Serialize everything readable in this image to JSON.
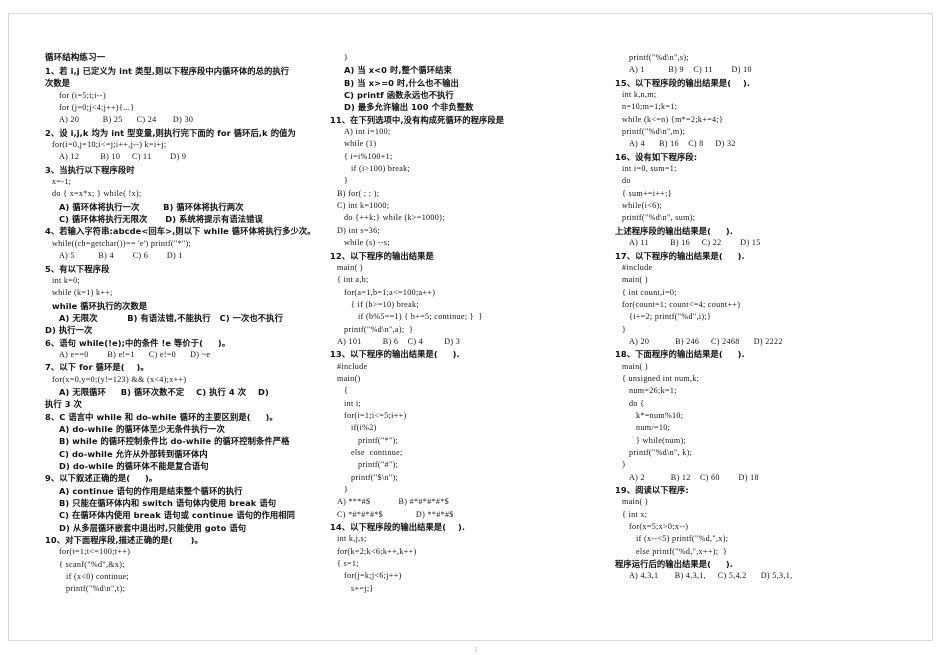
{
  "document": {
    "title": "循环结构练习一",
    "page_number": "1",
    "page_count_columns": 3
  },
  "columns": [
    {
      "name": "column-1",
      "lines": [
        {
          "text": "循环结构练习一",
          "kind": "title",
          "indent": 0
        },
        {
          "text": "1、若 i,j 已定义为 int 类型,则以下程序段中内循环体的总的执行",
          "kind": "cn",
          "indent": 0
        },
        {
          "text": "次数是",
          "kind": "cn",
          "indent": 0
        },
        {
          "text": "for (i=5;i;i--)",
          "kind": "code",
          "indent": 2
        },
        {
          "text": "for (j=0;j<4;j++){...}",
          "kind": "code",
          "indent": 2
        },
        {
          "text": "A) 20          B) 25      C) 24       D) 30",
          "kind": "code",
          "indent": 2
        },
        {
          "text": "2、设 i,j,k 均为 int 型变量,则执行完下面的 for 循环后,k 的值为",
          "kind": "cn",
          "indent": 0
        },
        {
          "text": "for(i=0,j=10;i<=j;i++,j--) k=i+j;",
          "kind": "code",
          "indent": 1
        },
        {
          "text": "A) 12         B) 10     C) 11        D) 9",
          "kind": "code",
          "indent": 2
        },
        {
          "text": "3、当执行以下程序段时",
          "kind": "cn",
          "indent": 0
        },
        {
          "text": "x=-1;",
          "kind": "code",
          "indent": 1
        },
        {
          "text": "do { x=x*x; } while( !x);",
          "kind": "code",
          "indent": 1
        },
        {
          "text": "A) 循环体将执行一次        B) 循环体将执行两次",
          "kind": "cn",
          "indent": 2
        },
        {
          "text": "C) 循环体将执行无限次      D) 系统将提示有语法错误",
          "kind": "cn",
          "indent": 2
        },
        {
          "text": "4、若输入字符串:abcde<回车>,则以下 while 循环体将执行多少次。",
          "kind": "cn",
          "indent": 0
        },
        {
          "text": "while((ch=getchar())== 'e') printf(\"*\");",
          "kind": "code",
          "indent": 1
        },
        {
          "text": "A) 5          B) 4        C) 6        D) 1",
          "kind": "code",
          "indent": 2
        },
        {
          "text": "5、有以下程序段",
          "kind": "cn",
          "indent": 0
        },
        {
          "text": "int k=0;",
          "kind": "code",
          "indent": 1
        },
        {
          "text": "while (k=1) k++;",
          "kind": "code",
          "indent": 1
        },
        {
          "text": "while 循环执行的次数是",
          "kind": "cn",
          "indent": 1
        },
        {
          "text": "A) 无限次          B) 有语法错,不能执行   C) 一次也不执行",
          "kind": "cn",
          "indent": 2
        },
        {
          "text": "D) 执行一次",
          "kind": "cn",
          "indent": 0
        },
        {
          "text": "6、语句 while(!e);中的条件 !e 等价于(     )。",
          "kind": "cn",
          "indent": 0
        },
        {
          "text": "A) e==0        B) e!=1      C) e!=0      D) ~e",
          "kind": "code",
          "indent": 2
        },
        {
          "text": "7、以下 for 循环是(    )。",
          "kind": "cn",
          "indent": 0
        },
        {
          "text": "for(x=0,y=0;(y!=123) && (x<4);x++)",
          "kind": "code",
          "indent": 1
        },
        {
          "text": "A) 无限循环     B) 循环次数不定    C) 执行 4 次    D)",
          "kind": "cn",
          "indent": 2
        },
        {
          "text": "执行 3 次",
          "kind": "cn",
          "indent": 0
        },
        {
          "text": "8、C 语言中 while 和 do-while 循环的主要区别是(     )。",
          "kind": "cn",
          "indent": 0
        },
        {
          "text": "A) do-while 的循环体至少无条件执行一次",
          "kind": "cn",
          "indent": 2
        },
        {
          "text": "B) while 的循环控制条件比 do-while 的循环控制条件严格",
          "kind": "cn",
          "indent": 2
        },
        {
          "text": "C) do-while 允许从外部转到循环体内",
          "kind": "cn",
          "indent": 2
        },
        {
          "text": "D) do-while 的循环体不能是复合语句",
          "kind": "cn",
          "indent": 2
        },
        {
          "text": "9、以下叙述正确的是(     )。",
          "kind": "cn",
          "indent": 0
        },
        {
          "text": "A) continue 语句的作用是结束整个循环的执行",
          "kind": "cn",
          "indent": 2
        },
        {
          "text": "B) 只能在循环体内和 switch 语句体内使用 break 语句",
          "kind": "cn",
          "indent": 2
        },
        {
          "text": "C) 在循环体内使用 break 语句或 continue 语句的作用相同",
          "kind": "cn",
          "indent": 2
        },
        {
          "text": "D) 从多层循环嵌套中退出时,只能使用 goto 语句",
          "kind": "cn",
          "indent": 2
        },
        {
          "text": "10、对下面程序段,描述正确的是(      )。",
          "kind": "cn",
          "indent": 0
        },
        {
          "text": "for(t=1;t<=100;t++)",
          "kind": "code",
          "indent": 2
        },
        {
          "text": "{ scanf(\"%d\",&x);",
          "kind": "code",
          "indent": 2
        },
        {
          "text": "if (x<0) continue;",
          "kind": "code",
          "indent": 3
        },
        {
          "text": "printf(\"%d\\n\",t);",
          "kind": "code",
          "indent": 3
        }
      ]
    },
    {
      "name": "column-2",
      "lines": [
        {
          "text": "}",
          "kind": "code",
          "indent": 2
        },
        {
          "text": "A) 当 x<0 时,整个循环结束",
          "kind": "cn",
          "indent": 2
        },
        {
          "text": "B) 当 x>=0 时,什么也不输出",
          "kind": "cn",
          "indent": 2
        },
        {
          "text": "C) printf 函数永远也不执行",
          "kind": "cn",
          "indent": 2
        },
        {
          "text": "D) 最多允许输出 100 个非负整数",
          "kind": "cn",
          "indent": 2
        },
        {
          "text": "11、在下列选项中,没有构成死循环的程序段是",
          "kind": "cn",
          "indent": 0
        },
        {
          "text": "A) int i=100;",
          "kind": "code",
          "indent": 2
        },
        {
          "text": "while (1)",
          "kind": "code",
          "indent": 2
        },
        {
          "text": "{ i=i%100+1;",
          "kind": "code",
          "indent": 2
        },
        {
          "text": "if (i>100) break;",
          "kind": "code",
          "indent": 3
        },
        {
          "text": "}",
          "kind": "code",
          "indent": 2
        },
        {
          "text": "B) for( ; ; );",
          "kind": "code",
          "indent": 1
        },
        {
          "text": "C) int k=1000;",
          "kind": "code",
          "indent": 1
        },
        {
          "text": "do {++k;} while (k>=1000);",
          "kind": "code",
          "indent": 2
        },
        {
          "text": "D) int s=36;",
          "kind": "code",
          "indent": 1
        },
        {
          "text": "while (s) --s;",
          "kind": "code",
          "indent": 2
        },
        {
          "text": "12、以下程序的输出结果是",
          "kind": "cn",
          "indent": 0
        },
        {
          "text": "main( )",
          "kind": "code",
          "indent": 1
        },
        {
          "text": "{ int a,b;",
          "kind": "code",
          "indent": 1
        },
        {
          "text": "for(a=1,b=1;a<=100;a++)",
          "kind": "code",
          "indent": 2
        },
        {
          "text": "{ if (b>=10) break;",
          "kind": "code",
          "indent": 3
        },
        {
          "text": "if (b%5==1) { b+=5; continue; }  }",
          "kind": "code",
          "indent": 4
        },
        {
          "text": "printf(\"%d\\n\",a);  }",
          "kind": "code",
          "indent": 2
        },
        {
          "text": "A) 101         B) 6    C) 4         D) 3",
          "kind": "code",
          "indent": 1
        },
        {
          "text": "13、以下程序的输出结果是(     ).",
          "kind": "cn",
          "indent": 0
        },
        {
          "text": "#include",
          "kind": "code",
          "indent": 1
        },
        {
          "text": "main()",
          "kind": "code",
          "indent": 1
        },
        {
          "text": "{",
          "kind": "code",
          "indent": 2
        },
        {
          "text": "int i;",
          "kind": "code",
          "indent": 2
        },
        {
          "text": "for(i=1;i<=5;i++)",
          "kind": "code",
          "indent": 2
        },
        {
          "text": "if(i%2)",
          "kind": "code",
          "indent": 3
        },
        {
          "text": "printf(\"*\");",
          "kind": "code",
          "indent": 4
        },
        {
          "text": "else  continue;",
          "kind": "code",
          "indent": 3
        },
        {
          "text": "printf(\"#\");",
          "kind": "code",
          "indent": 4
        },
        {
          "text": "printf(\"$\\n\");",
          "kind": "code",
          "indent": 3
        },
        {
          "text": "}",
          "kind": "code",
          "indent": 2
        },
        {
          "text": "A) ***#$            B) #*#*#*#*$",
          "kind": "code",
          "indent": 1
        },
        {
          "text": "C) *#*#*#*$              D) **#*#$",
          "kind": "code",
          "indent": 1
        },
        {
          "text": "14、以下程序段的输出结果是(    ).",
          "kind": "cn",
          "indent": 0
        },
        {
          "text": "int k,j,s;",
          "kind": "code",
          "indent": 1
        },
        {
          "text": "for(k=2;k<6;k++,k++)",
          "kind": "code",
          "indent": 1
        },
        {
          "text": "{ s=1;",
          "kind": "code",
          "indent": 1
        },
        {
          "text": "for(j=k;j<6;j++)",
          "kind": "code",
          "indent": 2
        },
        {
          "text": "s+=j;}",
          "kind": "code",
          "indent": 3
        }
      ]
    },
    {
      "name": "column-3",
      "lines": [
        {
          "text": "printf(\"%d\\n\",s);",
          "kind": "code",
          "indent": 2
        },
        {
          "text": "A) 1          B) 9    C) 11        D) 10",
          "kind": "code",
          "indent": 2
        },
        {
          "text": "15、以下程序段的输出结果是(    ).",
          "kind": "cn",
          "indent": 0
        },
        {
          "text": "int k,n,m;",
          "kind": "code",
          "indent": 1
        },
        {
          "text": "n=10;m=1;k=1;",
          "kind": "code",
          "indent": 1
        },
        {
          "text": "while (k<=n) {m*=2;k+=4;}",
          "kind": "code",
          "indent": 1
        },
        {
          "text": "printf(\"%d\\n\",m);",
          "kind": "code",
          "indent": 1
        },
        {
          "text": "A) 4      B) 16    C) 8     D) 32",
          "kind": "code",
          "indent": 2
        },
        {
          "text": "16、设有如下程序段:",
          "kind": "cn",
          "indent": 0
        },
        {
          "text": "int i=0, sum=1;",
          "kind": "code",
          "indent": 1
        },
        {
          "text": "do",
          "kind": "code",
          "indent": 1
        },
        {
          "text": "{ sum+=i++;}",
          "kind": "code",
          "indent": 1
        },
        {
          "text": "while(i<6);",
          "kind": "code",
          "indent": 1
        },
        {
          "text": "printf(\"%d\\n\", sum);",
          "kind": "code",
          "indent": 1
        },
        {
          "text": "上述程序段的输出结果是(     ).",
          "kind": "cn",
          "indent": 0
        },
        {
          "text": "A) 11         B) 16     C) 22        D) 15",
          "kind": "code",
          "indent": 2
        },
        {
          "text": "17、以下程序的输出结果是(     ).",
          "kind": "cn",
          "indent": 0
        },
        {
          "text": "#include",
          "kind": "code",
          "indent": 1
        },
        {
          "text": "main( )",
          "kind": "code",
          "indent": 1
        },
        {
          "text": "{ int count,i=0;",
          "kind": "code",
          "indent": 1
        },
        {
          "text": "for(count=1; count<=4; count++)",
          "kind": "code",
          "indent": 1
        },
        {
          "text": "{i+=2; printf(\"%d\",i);}",
          "kind": "code",
          "indent": 2
        },
        {
          "text": "}",
          "kind": "code",
          "indent": 1
        },
        {
          "text": "A) 20           B) 246     C) 2468      D) 2222",
          "kind": "code",
          "indent": 2
        },
        {
          "text": "18、下面程序的输出结果是(     ).",
          "kind": "cn",
          "indent": 0
        },
        {
          "text": "main( )",
          "kind": "code",
          "indent": 1
        },
        {
          "text": "{ unsigned int num,k;",
          "kind": "code",
          "indent": 1
        },
        {
          "text": "num=26;k=1;",
          "kind": "code",
          "indent": 2
        },
        {
          "text": "do {",
          "kind": "code",
          "indent": 2
        },
        {
          "text": "k*=num%10;",
          "kind": "code",
          "indent": 3
        },
        {
          "text": "num/=10;",
          "kind": "code",
          "indent": 3
        },
        {
          "text": "} while(num);",
          "kind": "code",
          "indent": 3
        },
        {
          "text": "printf(\"%d\\n\", k);",
          "kind": "code",
          "indent": 2
        },
        {
          "text": "}",
          "kind": "code",
          "indent": 1
        },
        {
          "text": "A) 2           B) 12    C) 60        D) 18",
          "kind": "code",
          "indent": 2
        },
        {
          "text": "19、阅读以下程序:",
          "kind": "cn",
          "indent": 0
        },
        {
          "text": "main( )",
          "kind": "code",
          "indent": 1
        },
        {
          "text": "{ int x;",
          "kind": "code",
          "indent": 1
        },
        {
          "text": "for(x=5;x>0;x--)",
          "kind": "code",
          "indent": 2
        },
        {
          "text": "if (x--<5) printf(\"%d,\",x);",
          "kind": "code",
          "indent": 3
        },
        {
          "text": "else printf(\"%d,\",x++);  }",
          "kind": "code",
          "indent": 3
        },
        {
          "text": "程序运行后的输出结果是(     ).",
          "kind": "cn",
          "indent": 0
        },
        {
          "text": "A) 4,3,1       B) 4,3,1,     C) 5,4,2      D) 5,3,1,",
          "kind": "code",
          "indent": 2
        }
      ]
    }
  ]
}
